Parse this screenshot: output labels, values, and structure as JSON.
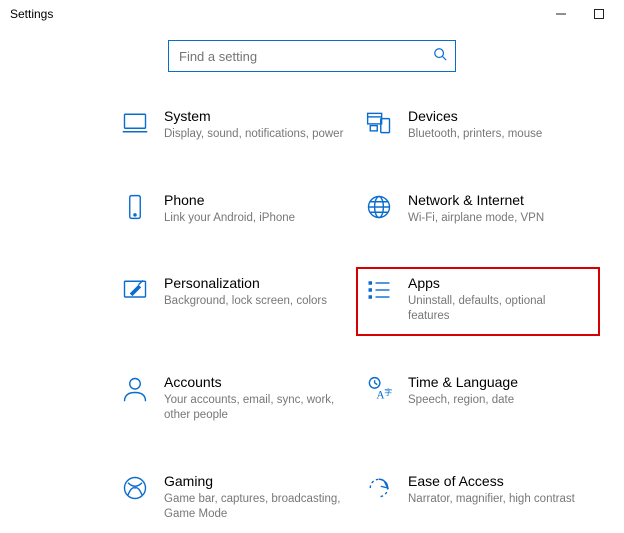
{
  "window": {
    "title": "Settings"
  },
  "search": {
    "placeholder": "Find a setting"
  },
  "categories": [
    {
      "id": "system",
      "label": "System",
      "sub": "Display, sound, notifications, power"
    },
    {
      "id": "devices",
      "label": "Devices",
      "sub": "Bluetooth, printers, mouse"
    },
    {
      "id": "phone",
      "label": "Phone",
      "sub": "Link your Android, iPhone"
    },
    {
      "id": "network",
      "label": "Network & Internet",
      "sub": "Wi-Fi, airplane mode, VPN"
    },
    {
      "id": "personalization",
      "label": "Personalization",
      "sub": "Background, lock screen, colors"
    },
    {
      "id": "apps",
      "label": "Apps",
      "sub": "Uninstall, defaults, optional features",
      "highlight": true
    },
    {
      "id": "accounts",
      "label": "Accounts",
      "sub": "Your accounts, email, sync, work, other people"
    },
    {
      "id": "time",
      "label": "Time & Language",
      "sub": "Speech, region, date"
    },
    {
      "id": "gaming",
      "label": "Gaming",
      "sub": "Game bar, captures, broadcasting, Game Mode"
    },
    {
      "id": "ease",
      "label": "Ease of Access",
      "sub": "Narrator, magnifier, high contrast"
    }
  ]
}
